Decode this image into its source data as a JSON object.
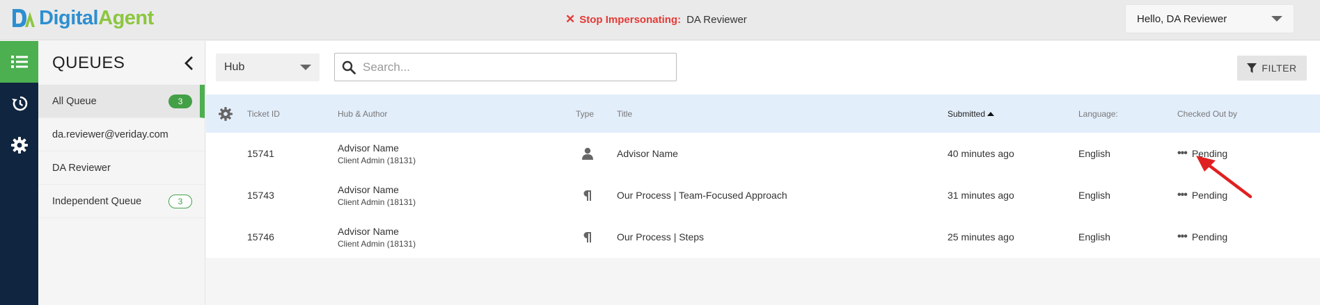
{
  "app": {
    "logo_text_part1": "Digital",
    "logo_text_part2": "Agent",
    "logo_mark": "DA"
  },
  "impersonation": {
    "stop_label": "Stop Impersonating:",
    "user": "DA Reviewer"
  },
  "user_menu": {
    "greeting": "Hello,  DA Reviewer"
  },
  "rail": {
    "items": [
      {
        "icon": "list-icon",
        "active": true
      },
      {
        "icon": "history-icon",
        "active": false
      },
      {
        "icon": "gear-icon",
        "active": false
      }
    ]
  },
  "queues": {
    "title": "QUEUES",
    "items": [
      {
        "label": "All Queue",
        "count": "3",
        "active": true
      },
      {
        "label": "da.reviewer@veriday.com",
        "count": null
      },
      {
        "label": "DA Reviewer",
        "count": null
      },
      {
        "label": "Independent Queue",
        "count": "3"
      }
    ]
  },
  "toolbar": {
    "hub_value": "Hub",
    "search_placeholder": "Search...",
    "filter_label": "FILTER"
  },
  "table": {
    "columns": {
      "ticket_id": "Ticket ID",
      "hub_author": "Hub & Author",
      "type": "Type",
      "title": "Title",
      "submitted": "Submitted",
      "language": "Language:",
      "checked_out_by": "Checked Out by"
    },
    "sort": {
      "column": "submitted",
      "direction": "ascending"
    },
    "rows": [
      {
        "ticket_id": "15741",
        "author": "Advisor Name",
        "author_sub": "Client Admin (18131)",
        "type_icon": "person-icon",
        "title": "Advisor Name",
        "submitted": "40 minutes ago",
        "language": "English",
        "checked_out": "Pending"
      },
      {
        "ticket_id": "15743",
        "author": "Advisor Name",
        "author_sub": "Client Admin (18131)",
        "type_icon": "paragraph-icon",
        "title": "Our Process | Team-Focused Approach",
        "submitted": "31 minutes ago",
        "language": "English",
        "checked_out": "Pending"
      },
      {
        "ticket_id": "15746",
        "author": "Advisor Name",
        "author_sub": "Client Admin (18131)",
        "type_icon": "paragraph-icon",
        "title": "Our Process | Steps",
        "submitted": "25 minutes ago",
        "language": "English",
        "checked_out": "Pending"
      }
    ]
  },
  "colors": {
    "brand_blue": "#2d8fd0",
    "brand_green": "#8cc63f",
    "accent_green": "#4caf50",
    "nav_dark": "#10253f",
    "header_row": "#e3eefb",
    "danger": "#e53935",
    "annotation_arrow": "#e02020"
  }
}
